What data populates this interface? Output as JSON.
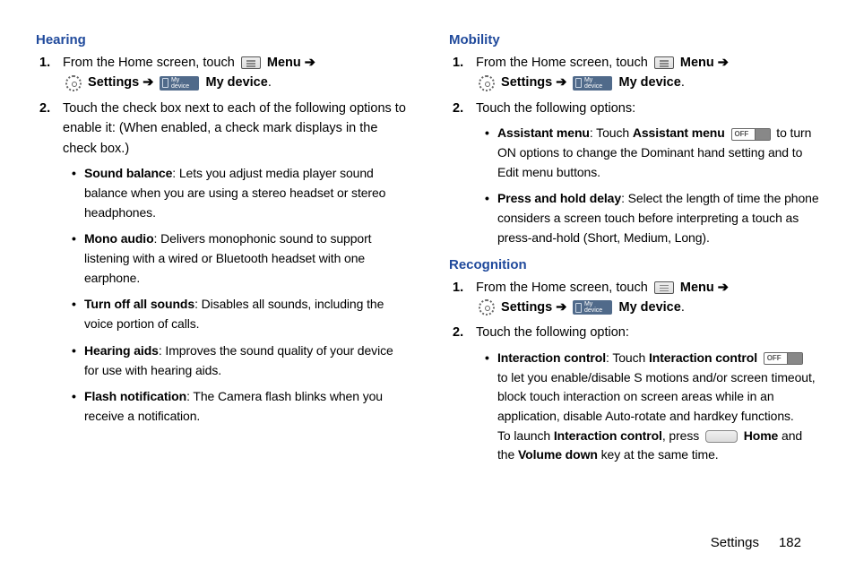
{
  "left": {
    "heading": "Hearing",
    "step1_a": "From the Home screen, touch",
    "step1_menu": "Menu",
    "step1_settings": "Settings",
    "step1_mydevice": "My device",
    "mydevice_icon_text": "My device",
    "step2": "Touch the check box next to each of the following options to enable it: (When enabled, a check mark displays in the check box.)",
    "bullets": {
      "b1_t": "Sound balance",
      "b1_d": ": Lets you adjust media player sound balance when you are using a stereo headset or stereo headphones.",
      "b2_t": "Mono audio",
      "b2_d": ": Delivers monophonic sound to support listening with a wired or Bluetooth headset with one earphone.",
      "b3_t": "Turn off all sounds",
      "b3_d": ": Disables all sounds, including the voice portion of calls.",
      "b4_t": "Hearing aids",
      "b4_d": ": Improves the sound quality of your device for use with hearing aids.",
      "b5_t": "Flash notification",
      "b5_d": ": The Camera flash blinks when you receive a notification."
    }
  },
  "right": {
    "mobility": {
      "heading": "Mobility",
      "step1_a": "From the Home screen, touch",
      "step1_menu": "Menu",
      "step1_settings": "Settings",
      "step1_mydevice": "My device",
      "step2": "Touch the following options:",
      "b1_t": "Assistant menu",
      "b1_d1": ": Touch ",
      "b1_d1b": "Assistant menu",
      "b1_d2": " to turn ON options to change the Dominant hand setting and to Edit menu buttons.",
      "b2_t": "Press and hold delay",
      "b2_d": ": Select the length of time the phone considers a screen touch before interpreting a touch as press-and-hold (Short, Medium, Long)."
    },
    "recognition": {
      "heading": "Recognition",
      "step1_a": "From the Home screen, touch",
      "step1_menu": "Menu",
      "step1_settings": "Settings",
      "step1_mydevice": "My device",
      "step2": "Touch the following option:",
      "b1_t": "Interaction control",
      "b1_d1": ": Touch ",
      "b1_d1b": "Interaction control",
      "b1_d2": " to let you enable/disable S motions and/or screen timeout, block touch interaction on screen areas while in an application, disable Auto-rotate and hardkey functions.",
      "b1_d3a": "To launch ",
      "b1_d3b": "Interaction control",
      "b1_d3c": ", press ",
      "b1_home": "Home",
      "b1_d3d": " and the ",
      "b1_voldown": "Volume down",
      "b1_d3e": " key at the same time."
    }
  },
  "footer": {
    "section": "Settings",
    "page": "182"
  },
  "toggle_label": "OFF",
  "arrow": "➔"
}
